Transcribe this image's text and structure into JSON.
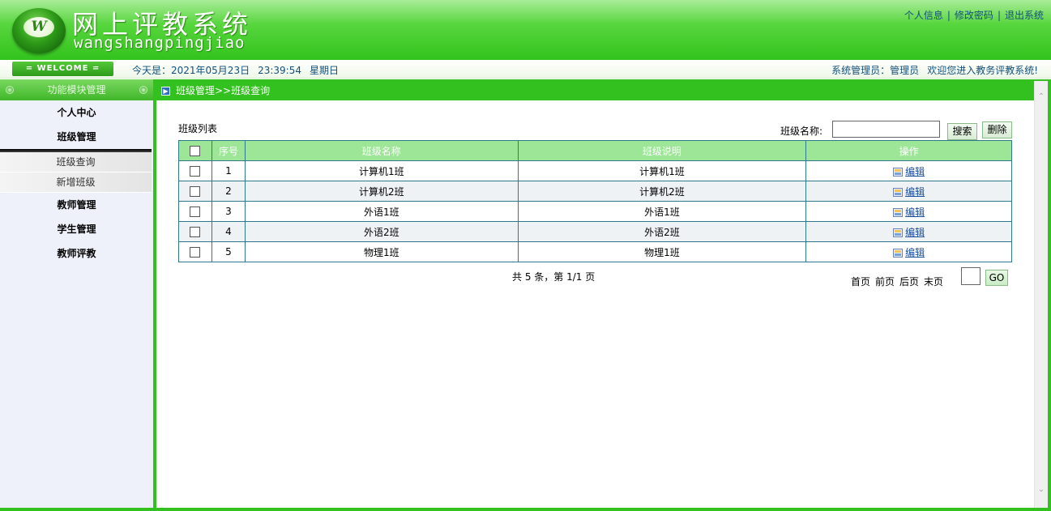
{
  "header": {
    "logo_letter": "W",
    "title": "网上评教系统",
    "subtitle": "wangshangpingjiao",
    "links": [
      "个人信息",
      "修改密码",
      "退出系统"
    ]
  },
  "infobar": {
    "welcome": "= WELCOME =",
    "today_label": "今天是：2021年05月23日",
    "time": "23:39:54",
    "weekday": "星期日",
    "admin_label": "系统管理员：管理员",
    "welcome_msg": "欢迎您进入教务评教系统!"
  },
  "sidebar": {
    "heading": "功能模块管理",
    "items": [
      {
        "label": "个人中心"
      },
      {
        "label": "班级管理"
      },
      {
        "label": "教师管理"
      },
      {
        "label": "学生管理"
      },
      {
        "label": "教师评教"
      }
    ],
    "submenu": [
      {
        "label": "班级查询"
      },
      {
        "label": "新增班级"
      }
    ]
  },
  "breadcrumb": "班级管理>>班级查询",
  "list": {
    "title": "班级列表",
    "search_label": "班级名称:",
    "search_value": "",
    "search_button": "搜索",
    "delete_button": "删除",
    "columns": [
      "序号",
      "班级名称",
      "班级说明",
      "操作"
    ],
    "rows": [
      {
        "no": "1",
        "name": "计算机1班",
        "desc": "计算机1班",
        "action": "编辑"
      },
      {
        "no": "2",
        "name": "计算机2班",
        "desc": "计算机2班",
        "action": "编辑"
      },
      {
        "no": "3",
        "name": "外语1班",
        "desc": "外语1班",
        "action": "编辑"
      },
      {
        "no": "4",
        "name": "外语2班",
        "desc": "外语2班",
        "action": "编辑"
      },
      {
        "no": "5",
        "name": "物理1班",
        "desc": "物理1班",
        "action": "编辑"
      }
    ]
  },
  "pager": {
    "summary": "共 5 条，第 1/1 页",
    "first": "首页",
    "prev": "前页",
    "next": "后页",
    "last": "末页",
    "page_value": "",
    "go": "GO"
  }
}
